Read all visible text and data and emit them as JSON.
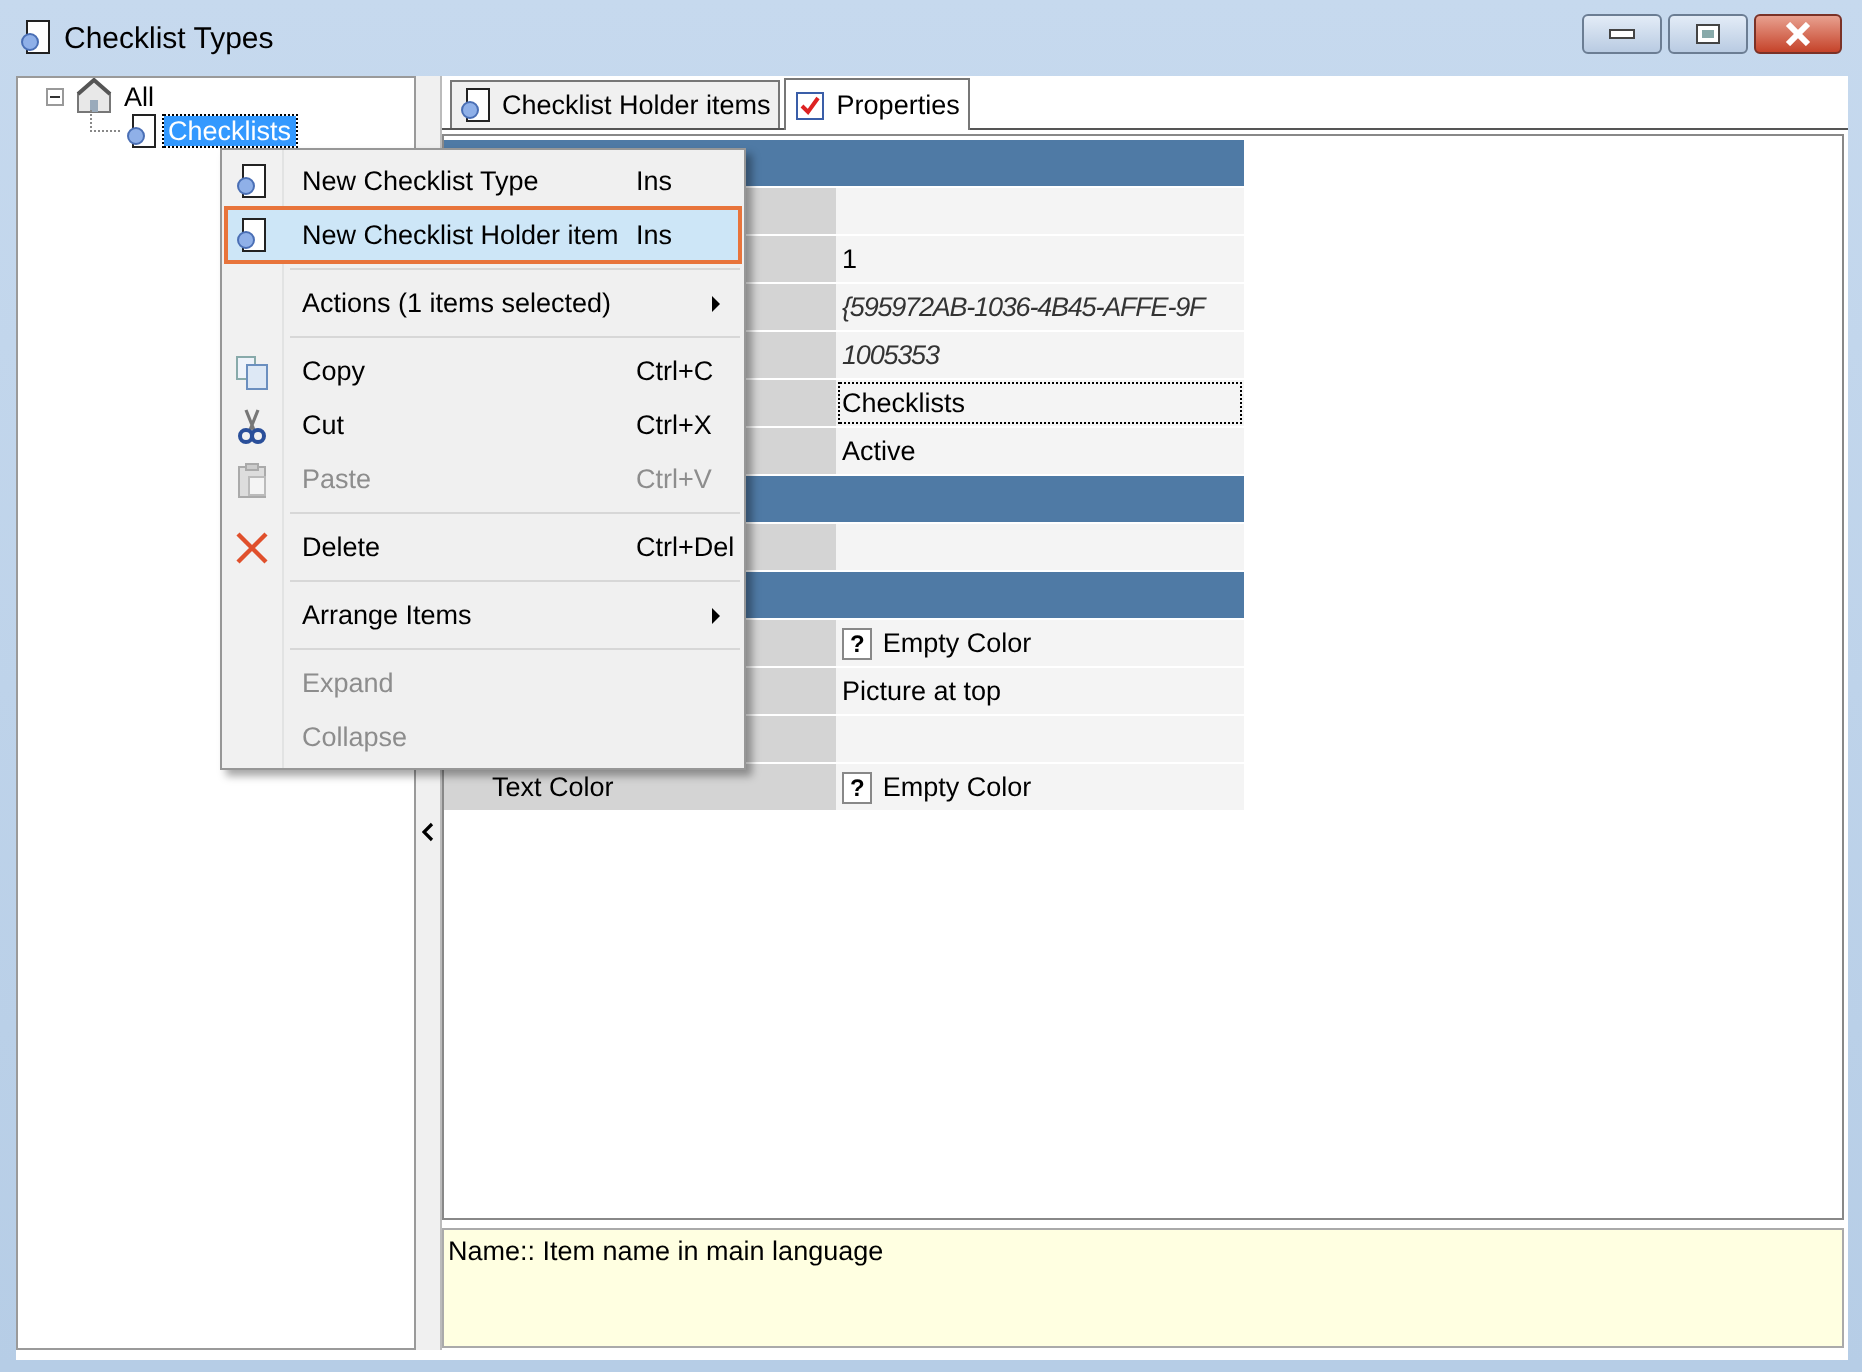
{
  "window": {
    "title": "Checklist Types"
  },
  "tree": [
    {
      "label": "All",
      "expanded": true,
      "selected": false,
      "children": [
        {
          "label": "Checklists",
          "selected": true
        }
      ]
    }
  ],
  "tabs": [
    {
      "label": "Checklist Holder items",
      "selected": false
    },
    {
      "label": "Properties",
      "selected": true
    }
  ],
  "properties": [
    {
      "kind": "category"
    },
    {
      "kind": "row"
    },
    {
      "kind": "row",
      "value": "1"
    },
    {
      "kind": "row",
      "value": "{595972AB-1036-4B45-AFFE-9F",
      "italic": true
    },
    {
      "kind": "row",
      "value": "1005353",
      "italic": true
    },
    {
      "kind": "row",
      "value": "Checklists",
      "focused": true
    },
    {
      "kind": "row",
      "value": "Active"
    },
    {
      "kind": "category"
    },
    {
      "kind": "row"
    },
    {
      "kind": "category"
    },
    {
      "kind": "color",
      "swatch": "?",
      "value": "Empty Color"
    },
    {
      "kind": "row",
      "value": "Picture at top"
    },
    {
      "kind": "row"
    },
    {
      "kind": "color",
      "name": "Text Color",
      "swatch": "?",
      "value": "Empty Color"
    }
  ],
  "description": "Name:: Item name in main language",
  "context_menu": [
    {
      "kind": "checklist",
      "label": "New Checklist Type",
      "shortcut": "Ins",
      "selected": false,
      "disabled": false
    },
    {
      "kind": "checklist",
      "label": "New Checklist Holder item",
      "shortcut": "Ins",
      "selected": true,
      "disabled": false
    },
    {
      "kind": "separator"
    },
    {
      "kind": "submenu",
      "label": "Actions (1 items selected)",
      "selected": false,
      "disabled": false
    },
    {
      "kind": "separator"
    },
    {
      "kind": "copy",
      "label": "Copy",
      "shortcut": "Ctrl+C",
      "selected": false,
      "disabled": false
    },
    {
      "kind": "cut",
      "label": "Cut",
      "shortcut": "Ctrl+X",
      "selected": false,
      "disabled": false
    },
    {
      "kind": "paste",
      "label": "Paste",
      "shortcut": "Ctrl+V",
      "selected": false,
      "disabled": true
    },
    {
      "kind": "separator"
    },
    {
      "kind": "delete",
      "label": "Delete",
      "shortcut": "Ctrl+Del",
      "selected": false,
      "disabled": false
    },
    {
      "kind": "separator"
    },
    {
      "kind": "submenu",
      "label": "Arrange Items",
      "selected": false,
      "disabled": false
    },
    {
      "kind": "separator"
    },
    {
      "kind": "plain",
      "label": "Expand",
      "selected": false,
      "disabled": true
    },
    {
      "kind": "plain",
      "label": "Collapse",
      "selected": false,
      "disabled": true
    }
  ]
}
